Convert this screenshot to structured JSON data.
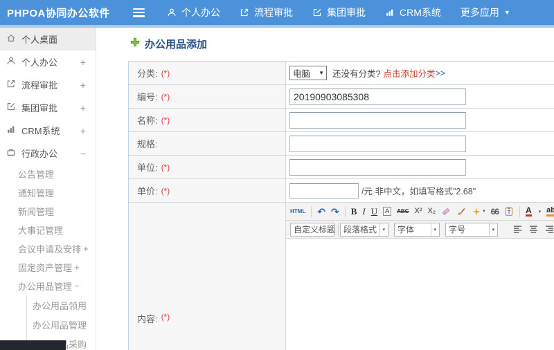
{
  "header": {
    "logo": "PHPOA协同办公软件",
    "nav": [
      {
        "label": "个人办公"
      },
      {
        "label": "流程审批"
      },
      {
        "label": "集团审批"
      },
      {
        "label": "CRM系统"
      },
      {
        "label": "更多应用"
      }
    ]
  },
  "sidebar": {
    "items": [
      {
        "label": "个人桌面"
      },
      {
        "label": "个人办公",
        "expand": "+"
      },
      {
        "label": "流程审批",
        "expand": "+"
      },
      {
        "label": "集团审批",
        "expand": "+"
      },
      {
        "label": "CRM系统",
        "expand": "+"
      },
      {
        "label": "行政办公",
        "expand": "−"
      },
      {
        "label": "公告管理"
      },
      {
        "label": "通知管理"
      },
      {
        "label": "新闻管理"
      },
      {
        "label": "大事记管理"
      },
      {
        "label": "会议申请及安排",
        "expand": "+"
      },
      {
        "label": "固定资产管理",
        "expand": "+"
      },
      {
        "label": "办公用品管理",
        "expand": "−"
      },
      {
        "label": "办公用品领用"
      },
      {
        "label": "办公用品管理"
      },
      {
        "label": "办公用品采购"
      }
    ]
  },
  "main": {
    "title": "办公用品添加",
    "form": {
      "required_mark": "(*)",
      "labels": {
        "category": "分类:",
        "code": "编号:",
        "name": "名称:",
        "spec": "规格:",
        "unit": "单位:",
        "price": "单价:",
        "content": "内容:"
      },
      "category": {
        "select_value": "电脑",
        "hint": "还没有分类?",
        "link": "点击添加分类",
        "link_arrows": ">>"
      },
      "code_value": "20190903085308",
      "price_note": "/元 非中文，如填写格式\"2.68\""
    }
  },
  "editor": {
    "toolbar": {
      "source": "HTML",
      "bold": "B",
      "italic": "I",
      "underline": "U",
      "anchor": "A",
      "strike": "ABC",
      "superscript": "X²",
      "subscript": "X₂",
      "quote": "66",
      "font_color": "A",
      "highlight": "ab",
      "selects": [
        {
          "label": "自定义标题"
        },
        {
          "label": "段落格式"
        },
        {
          "label": "字体"
        },
        {
          "label": "字号"
        }
      ]
    }
  },
  "icons": {
    "caret_down": "▼",
    "caret_small": "▾",
    "undo": "↶",
    "redo": "↷"
  },
  "colors": {
    "header_bg": "#4b92db",
    "title_blue": "#2a5384",
    "link_blue": "#2e6cb5",
    "link_red": "#c4432e",
    "required_red": "#e03c3c",
    "add_icon_green": "#7fc041"
  }
}
